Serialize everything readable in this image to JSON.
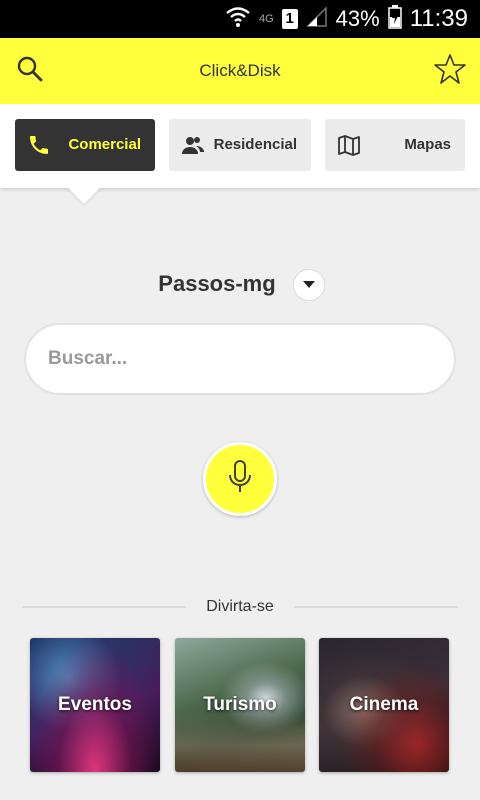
{
  "status_bar": {
    "network_type": "4G",
    "sim_slot": "1",
    "battery_percent": "43%",
    "time": "11:39",
    "icons": [
      "wifi-icon",
      "signal-icon",
      "battery-icon"
    ]
  },
  "app_bar": {
    "title": "Click&Disk",
    "left_icon": "search-icon",
    "right_icon": "star-icon"
  },
  "tabs": [
    {
      "label": "Comercial",
      "icon": "phone-icon",
      "active": true
    },
    {
      "label": "Residencial",
      "icon": "people-icon",
      "active": false
    },
    {
      "label": "Mapas",
      "icon": "map-icon",
      "active": false
    }
  ],
  "location": {
    "city": "Passos-mg",
    "dropdown_icon": "chevron-down-icon"
  },
  "search": {
    "placeholder": "Buscar..."
  },
  "mic": {
    "icon": "microphone-icon"
  },
  "section": {
    "title": "Divirta-se"
  },
  "cards": [
    {
      "label": "Eventos"
    },
    {
      "label": "Turismo"
    },
    {
      "label": "Cinema"
    }
  ],
  "colors": {
    "accent": "#ffff3b",
    "active_tab_bg": "#333333",
    "background": "#efefef"
  }
}
